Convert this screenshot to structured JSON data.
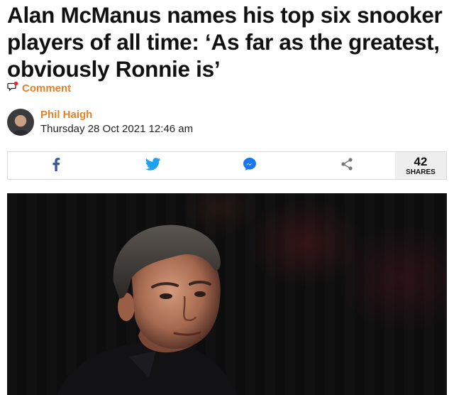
{
  "article": {
    "headline": "Alan McManus names his top six snooker players of all time: ‘As far as the greatest, obviously Ronnie is’"
  },
  "comment": {
    "label": "Comment",
    "icon": "comment-icon"
  },
  "author": {
    "name": "Phil Haigh",
    "date": "Thursday 28 Oct 2021 12:46 am"
  },
  "share": {
    "buttons": [
      {
        "icon": "facebook-icon"
      },
      {
        "icon": "twitter-icon"
      },
      {
        "icon": "messenger-icon"
      },
      {
        "icon": "share-icon"
      }
    ],
    "count": "42",
    "count_label": "SHARES",
    "colors": {
      "facebook": "#3b5998",
      "twitter": "#1da1f2",
      "messenger": "#1877f2",
      "share": "#777777"
    }
  },
  "colors": {
    "accent": "#e0822a"
  }
}
